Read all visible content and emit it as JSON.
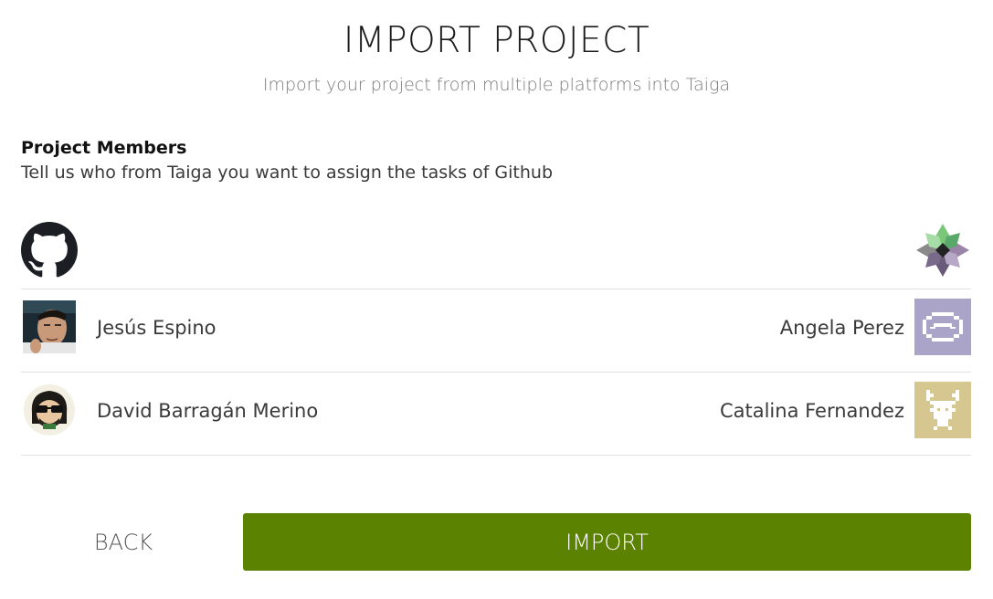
{
  "header": {
    "title": "IMPORT PROJECT",
    "subtitle": "Import your project from multiple platforms into Taiga"
  },
  "members_section": {
    "title": "Project Members",
    "description": "Tell us who from Taiga you want to assign the tasks of Github",
    "source_logo_icon": "github-logo-icon",
    "target_logo_icon": "taiga-logo-icon",
    "rows": [
      {
        "source_name": "Jesús Espino",
        "target_name": "Angela Perez"
      },
      {
        "source_name": "David Barragán Merino",
        "target_name": "Catalina Fernandez"
      }
    ]
  },
  "actions": {
    "back_label": "BACK",
    "import_label": "IMPORT"
  },
  "colors": {
    "accent": "#5b8200",
    "divider": "#e2e2e2"
  }
}
